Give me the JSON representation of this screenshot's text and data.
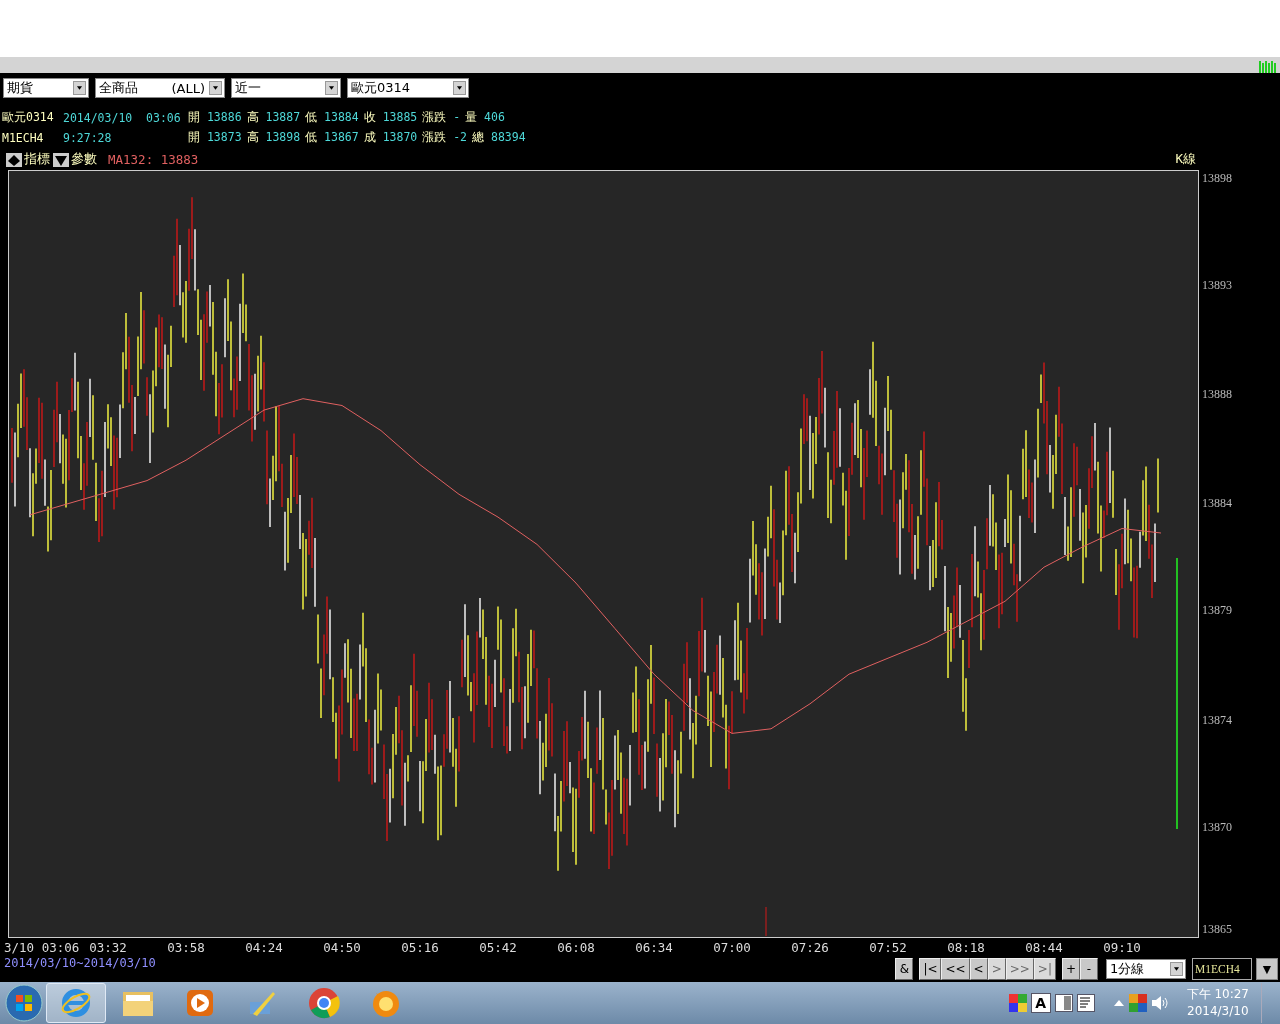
{
  "selectors": [
    {
      "value": "期貨"
    },
    {
      "value": "全商品",
      "tag": "(ALL)"
    },
    {
      "value": "近一"
    },
    {
      "value": "歐元0314"
    }
  ],
  "quote_lines": [
    {
      "name": "歐元0314",
      "time": "2014/03/10  03:06",
      "fields": [
        {
          "label": "開",
          "value": "13886"
        },
        {
          "label": "高",
          "value": "13887"
        },
        {
          "label": "低",
          "value": "13884"
        },
        {
          "label": "收",
          "value": "13885"
        },
        {
          "label": "漲跌",
          "value": "-"
        },
        {
          "label": "量",
          "value": "406"
        }
      ]
    },
    {
      "name": "M1ECH4",
      "time": "9:27:28",
      "fields": [
        {
          "label": "開",
          "value": "13873"
        },
        {
          "label": "高",
          "value": "13898"
        },
        {
          "label": "低",
          "value": "13867"
        },
        {
          "label": "成",
          "value": "13870"
        },
        {
          "label": "漲跌",
          "value": "-2"
        },
        {
          "label": "總",
          "value": "88394"
        }
      ]
    }
  ],
  "indicator_bar": {
    "buttons": [
      {
        "kind": "up",
        "label": "指標"
      },
      {
        "kind": "down",
        "label": "參數"
      }
    ],
    "ma_value": ": 13883",
    "chart_kind": "K線"
  },
  "chart_data": {
    "type": "line",
    "categories": [
      "3/10 03:06",
      null,
      "03:32",
      null,
      "03:58",
      null,
      "04:24",
      null,
      "04:50",
      null,
      "05:16",
      null,
      "05:42",
      null,
      "06:08",
      null,
      "06:34",
      null,
      "07:00",
      null,
      "07:26",
      null,
      "07:52",
      null,
      "08:18",
      null,
      "08:44",
      null,
      "09:10",
      null
    ],
    "series": [
      {
        "name": "MA132",
        "color": "#e06060",
        "values": [
          13883.2,
          13883.7,
          13884.2,
          13884.7,
          13885.6,
          13886.7,
          13887.8,
          13888.3,
          13888.0,
          13886.9,
          13885.4,
          13884.1,
          13883.1,
          13881.9,
          13880.2,
          13878.2,
          13876.2,
          13874.6,
          13873.6,
          13873.8,
          13874.9,
          13876.2,
          13876.9,
          13877.6,
          13878.5,
          13879.4,
          13880.9,
          13881.8,
          13882.6,
          13882.4
        ]
      }
    ],
    "ylim": [
      13864.7,
      13898.3
    ],
    "yticks": [
      {
        "value": 13898,
        "label": "13898"
      },
      {
        "value": 13893.3,
        "label": "13893"
      },
      {
        "value": 13888.5,
        "label": "13888"
      },
      {
        "value": 13883.7,
        "label": "13884"
      },
      {
        "value": 13879,
        "label": "13879"
      },
      {
        "value": 13874.2,
        "label": "13874"
      },
      {
        "value": 13869.5,
        "label": "13870"
      },
      {
        "value": 13865,
        "label": "13865"
      }
    ]
  },
  "range_text": "2014/03/10~2014/03/10",
  "nav_buttons": [
    {
      "label": "&",
      "disabled": false
    },
    {
      "label": "|<",
      "disabled": false
    },
    {
      "label": "<<",
      "disabled": false
    },
    {
      "label": "<",
      "disabled": false
    },
    {
      "label": ">",
      "disabled": true
    },
    {
      "label": ">>",
      "disabled": true
    },
    {
      "label": ">|",
      "disabled": true
    },
    {
      "label": "+",
      "disabled": false
    },
    {
      "label": "-",
      "disabled": false
    }
  ],
  "interval_select": {
    "value": "1分線"
  },
  "symbol_field": {
    "value": "M1ECH4"
  },
  "menu_button": "▼",
  "taskbar_apps": [
    {
      "kind": "ie",
      "active": true
    },
    {
      "kind": "folder",
      "active": false
    },
    {
      "kind": "player",
      "active": false
    },
    {
      "kind": "tool",
      "active": false
    },
    {
      "kind": "chrome",
      "active": false
    },
    {
      "kind": "bubble",
      "active": false
    }
  ],
  "tray": {
    "ime": "A",
    "time": "下午 10:27",
    "date": "2014/3/10"
  }
}
